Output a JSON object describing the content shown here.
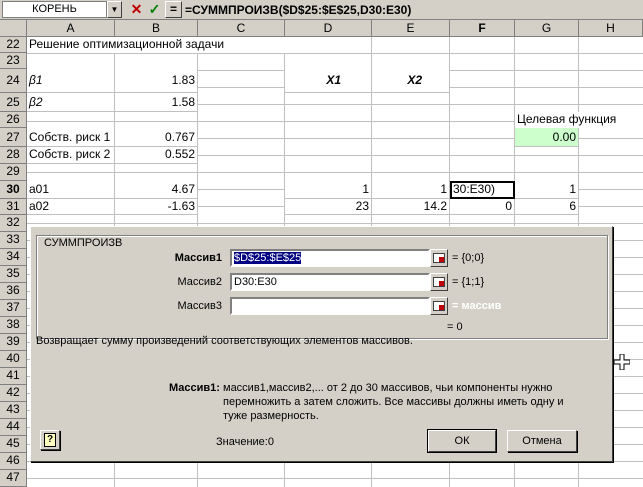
{
  "formula_bar": {
    "name_box": "КОРЕНЬ",
    "formula": "=СУММПРОИЗВ($D$25:$E$25,D30:E30)"
  },
  "columns": [
    "A",
    "B",
    "C",
    "D",
    "E",
    "F",
    "G",
    "H"
  ],
  "rows": [
    "22",
    "23",
    "24",
    "25",
    "26",
    "27",
    "28",
    "29",
    "30",
    "31",
    "32",
    "33",
    "34",
    "35",
    "36",
    "37",
    "38",
    "39",
    "40",
    "41",
    "42",
    "43",
    "44",
    "45",
    "46",
    "47"
  ],
  "cells": {
    "a22": "Решение оптимизационной задачи",
    "a24": "β1",
    "b24": "1.83",
    "d24": "X1",
    "e24": "X2",
    "a25": "β2",
    "b25": "1.58",
    "g26": "Целевая функция",
    "a27": "Собств. риск 1",
    "b27": "0.767",
    "g27": "0.00",
    "a28": "Собств. риск 2",
    "b28": "0.552",
    "a30": "a01",
    "b30": "4.67",
    "d30": "1",
    "e30": "1",
    "f30": "30:E30)",
    "g30": "1",
    "a31": "a02",
    "b31": "-1.63",
    "d31": "23",
    "e31": "14.2",
    "f31": "0",
    "g31": "6"
  },
  "dialog": {
    "title": "СУММПРОИЗВ",
    "args": [
      {
        "label": "Массив1",
        "value": "$D$25:$E$25",
        "result": "= {0;0}"
      },
      {
        "label": "Массив2",
        "value": "D30:E30",
        "result": "= {1;1}"
      },
      {
        "label": "Массив3",
        "value": "",
        "result": "= массив"
      }
    ],
    "total": "= 0",
    "description": "Возвращает сумму произведений соответствующих элементов массивов.",
    "arg_help_label": "Массив1:",
    "arg_help_text": "массив1,массив2,... от 2 до 30 массивов, чьи компоненты нужно перемножить а затем сложить. Все массивы должны иметь одну и туже размерность.",
    "value_text": "Значение:0",
    "ok_label": "ОК",
    "cancel_label": "Отмена",
    "help_label": "?"
  }
}
